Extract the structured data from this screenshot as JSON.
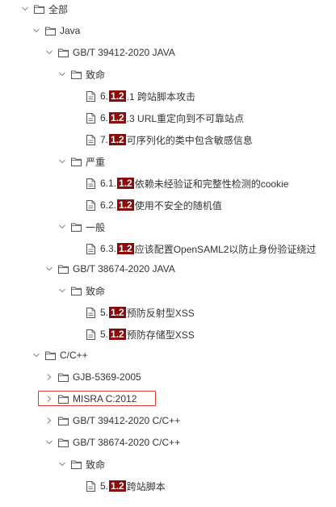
{
  "tree": {
    "root": {
      "label": "全部"
    },
    "java": {
      "label": "Java"
    },
    "java_gbt39412": {
      "label": "GB/T 39412-2020 JAVA"
    },
    "java_gbt39412_fatal": {
      "label": "致命"
    },
    "leaf_a1": {
      "pre": "6.",
      "hl": "1.2",
      "rest": ".1 跨站脚本攻击"
    },
    "leaf_a2": {
      "pre": "6.",
      "hl": "1.2",
      "rest": ".3 URL重定向到不可靠站点"
    },
    "leaf_a3": {
      "pre": "7.",
      "hl": "1.2",
      "rest": " 可序列化的类中包含敏感信息"
    },
    "java_gbt39412_severe": {
      "label": "严重"
    },
    "leaf_b1": {
      "pre": "6.1.",
      "hl": "1.2",
      "rest": " 依赖未经验证和完整性检测的cookie"
    },
    "leaf_b2": {
      "pre": "6.2.",
      "hl": "1.2",
      "rest": " 使用不安全的随机值"
    },
    "java_gbt39412_general": {
      "label": "一般"
    },
    "leaf_c1": {
      "pre": "6.3.",
      "hl": "1.2",
      "rest": " 应该配置OpenSAML2以防止身份验证绕过"
    },
    "java_gbt38674": {
      "label": "GB/T 38674-2020 JAVA"
    },
    "java_gbt38674_fatal": {
      "label": "致命"
    },
    "leaf_d1": {
      "pre": "5.",
      "hl": "1.2",
      "rest": " 预防反射型XSS"
    },
    "leaf_d2": {
      "pre": "5.",
      "hl": "1.2",
      "rest": " 预防存储型XSS"
    },
    "cpp": {
      "label": "C/C++"
    },
    "cpp_gjb": {
      "label": "GJB-5369-2005"
    },
    "cpp_misra": {
      "label": "MISRA C:2012"
    },
    "cpp_gbt39412": {
      "label": "GB/T 39412-2020 C/C++"
    },
    "cpp_gbt38674": {
      "label": "GB/T 38674-2020 C/C++"
    },
    "cpp_gbt38674_fatal": {
      "label": "致命"
    },
    "leaf_e1": {
      "pre": "5.",
      "hl": "1.2",
      "rest": " 跨站脚本"
    }
  },
  "colors": {
    "highlight_bg": "#8e0a0a",
    "annotation_box": "#e03a2e"
  }
}
